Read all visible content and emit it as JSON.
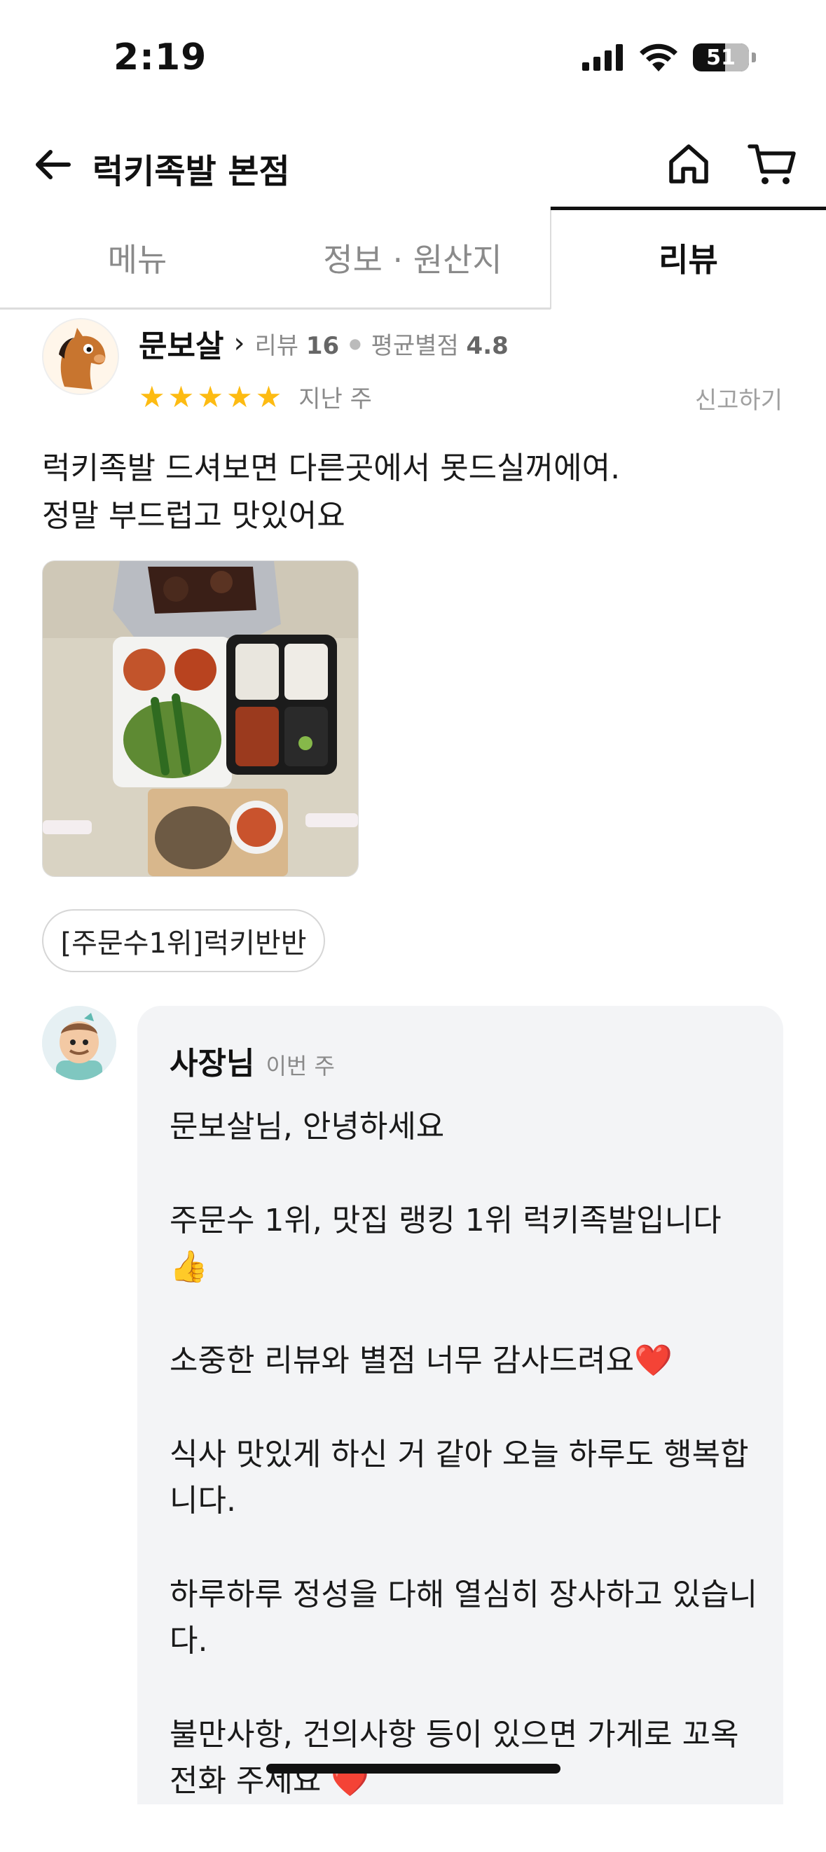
{
  "status_bar": {
    "time": "2:19",
    "battery": "51"
  },
  "header": {
    "title": "럭키족발 본점"
  },
  "tabs": [
    {
      "label": "메뉴",
      "active": false
    },
    {
      "label": "정보 · 원산지",
      "active": false
    },
    {
      "label": "리뷰",
      "active": true
    }
  ],
  "review": {
    "reviewer_name": "문보살",
    "review_count_label": "리뷰",
    "review_count": "16",
    "avg_rating_label": "평균별점",
    "avg_rating": "4.8",
    "stars": 5,
    "time": "지난 주",
    "report_label": "신고하기",
    "text_line1": "럭키족발 드셔보면 다른곳에서 못드실꺼에여.",
    "text_line2": "정말 부드럽고 맛있어요",
    "menu_chip": "[주문수1위]럭키반반"
  },
  "owner_reply": {
    "author": "사장님",
    "time": "이번 주",
    "paragraphs": [
      "문보살님, 안녕하세요",
      "주문수 1위, 맛집 랭킹 1위 럭키족발입니다👍",
      "소중한 리뷰와 별점 너무 감사드려요❤️",
      "식사 맛있게 하신 거 같아 오늘 하루도 행복합니다.",
      "하루하루 정성을 다해 열심히 장사하고 있습니다.",
      "불만사항, 건의사항 등이 있으면 가게로 꼬옥 전화 주세요 ❤️"
    ]
  },
  "colors": {
    "star": "#fdbb12",
    "accent": "#111111",
    "reply_bg": "#f3f4f6"
  },
  "icons": [
    "back-arrow-icon",
    "home-icon",
    "cart-icon",
    "signal-icon",
    "wifi-icon",
    "battery-icon",
    "star-icon",
    "chevron-right-icon"
  ]
}
